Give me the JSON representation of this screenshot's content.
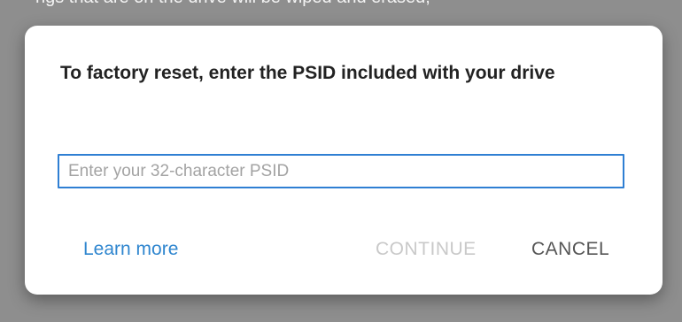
{
  "background": {
    "partial_text": "ngs that are on the drive will be wiped and erased,"
  },
  "dialog": {
    "title": "To factory reset, enter the PSID included with your drive",
    "psid_input": {
      "value": "",
      "placeholder": "Enter your 32-character PSID"
    },
    "learn_more_label": "Learn more",
    "continue_label": "CONTINUE",
    "cancel_label": "CANCEL"
  },
  "colors": {
    "accent": "#2f7fd3",
    "link": "#2f86cf",
    "disabled": "#c9c9c9",
    "overlay": "#8e8e8e"
  }
}
